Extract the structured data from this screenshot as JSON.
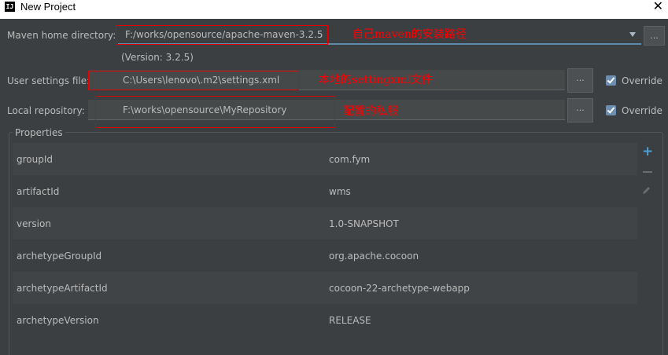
{
  "window": {
    "title": "New Project",
    "app_icon_text": "IJ",
    "close_glyph": "✕"
  },
  "maven_home": {
    "label": "Maven home directory:",
    "value": "F:/works/opensource/apache-maven-3.2.5",
    "version": "(Version: 3.2.5)",
    "browse_label": "..."
  },
  "user_settings": {
    "label": "User settings file:",
    "value": "C:\\Users\\lenovo\\.m2\\settings.xml",
    "browse_label": "...",
    "override_label": "Override",
    "override_checked": true
  },
  "local_repo": {
    "label": "Local repository:",
    "value": "F:\\works\\opensource\\MyRepository",
    "browse_label": "...",
    "override_label": "Override",
    "override_checked": true
  },
  "annotations": {
    "maven_home_note": "自己maven的安装路径",
    "settings_note": "本地的settingxml文件",
    "repo_note": "配置的私服"
  },
  "properties": {
    "title": "Properties",
    "rows": [
      {
        "key": "groupId",
        "value": "com.fym"
      },
      {
        "key": "artifactId",
        "value": "wms"
      },
      {
        "key": "version",
        "value": "1.0-SNAPSHOT"
      },
      {
        "key": "archetypeGroupId",
        "value": "org.apache.cocoon"
      },
      {
        "key": "archetypeArtifactId",
        "value": "cocoon-22-archetype-webapp"
      },
      {
        "key": "archetypeVersion",
        "value": "RELEASE"
      }
    ]
  },
  "side_tools": {
    "add_icon": "plus-icon",
    "remove_icon": "minus-icon",
    "edit_icon": "pencil-icon"
  },
  "colors": {
    "accent": "#5d8aa8",
    "annotation_red": "#ff0000",
    "add_blue": "#4a9ed8"
  }
}
